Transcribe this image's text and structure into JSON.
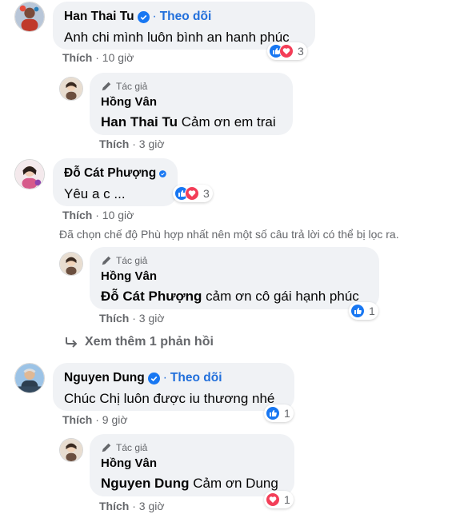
{
  "comments": [
    {
      "author": "Han Thai Tu",
      "follow": "Theo dõi",
      "text": "Anh chi mình luôn bình an hanh phúc",
      "like_label": "Thích",
      "time": "10 giờ",
      "reactions": "3",
      "reply": {
        "author_badge": "Tác giả",
        "author": "Hồng Vân",
        "mention": "Han Thai Tu",
        "text": "Cảm ơn em trai",
        "like_label": "Thích",
        "time": "3 giờ"
      }
    },
    {
      "author": "Đỗ Cát Phượng",
      "text": "Yêu a c ...",
      "like_label": "Thích",
      "time": "10 giờ",
      "reactions": "3",
      "filter_note": "Đã chọn chế độ Phù hợp nhất nên một số câu trả lời có thể bị lọc ra.",
      "reply": {
        "author_badge": "Tác giả",
        "author": "Hồng Vân",
        "mention": "Đỗ Cát Phượng",
        "text": "cảm ơn cô gái hạnh phúc",
        "like_label": "Thích",
        "time": "3 giờ",
        "reactions": "1"
      },
      "more_replies": "Xem thêm 1 phản hồi"
    },
    {
      "author": "Nguyen Dung",
      "follow": "Theo dõi",
      "text": "Chúc Chị luôn được iu thương nhé",
      "like_label": "Thích",
      "time": "9 giờ",
      "reactions": "1",
      "reply": {
        "author_badge": "Tác giả",
        "author": "Hồng Vân",
        "mention": "Nguyen Dung",
        "text": "Cảm ơn Dung",
        "like_label": "Thích",
        "time": "3 giờ",
        "reactions": "1"
      }
    }
  ],
  "colors": {
    "link_blue": "#216fdb",
    "bubble": "#f0f2f5",
    "meta_gray": "#65676b",
    "like_blue": "#1877f2",
    "love_red": "#f33e58"
  },
  "icons": [
    "verified-badge-icon",
    "pencil-icon",
    "like-reaction-icon",
    "love-reaction-icon",
    "reply-arrow-icon"
  ]
}
